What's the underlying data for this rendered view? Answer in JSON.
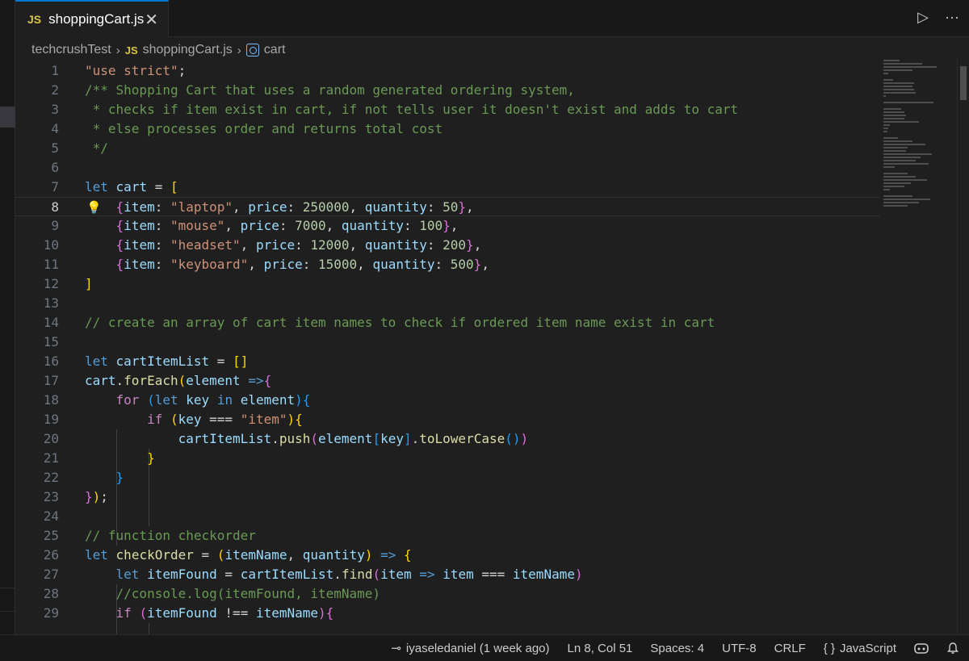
{
  "tab": {
    "icon": "JS",
    "title": "shoppingCart.js",
    "close": "✕"
  },
  "tab_actions": {
    "run": "▷",
    "more": "···"
  },
  "breadcrumb": {
    "folder": "techcrushTest",
    "file_icon": "JS",
    "file": "shoppingCart.js",
    "symbol": "cart"
  },
  "editor": {
    "current_line": 8,
    "lines": [
      1,
      2,
      3,
      4,
      5,
      6,
      7,
      8,
      9,
      10,
      11,
      12,
      13,
      14,
      15,
      16,
      17,
      18,
      19,
      20,
      21,
      22,
      23,
      24,
      25,
      26,
      27,
      28,
      29
    ]
  },
  "status": {
    "blame": "iyaseledaniel (1 week ago)",
    "position": "Ln 8, Col 51",
    "spaces": "Spaces: 4",
    "encoding": "UTF-8",
    "eol": "CRLF",
    "language": "JavaScript",
    "language_icon": "{ }"
  },
  "icons": {
    "blame": "git-commit-icon",
    "copilot": "copilot-icon",
    "bell": "bell-icon",
    "lightbulb": "lightbulb-icon"
  }
}
